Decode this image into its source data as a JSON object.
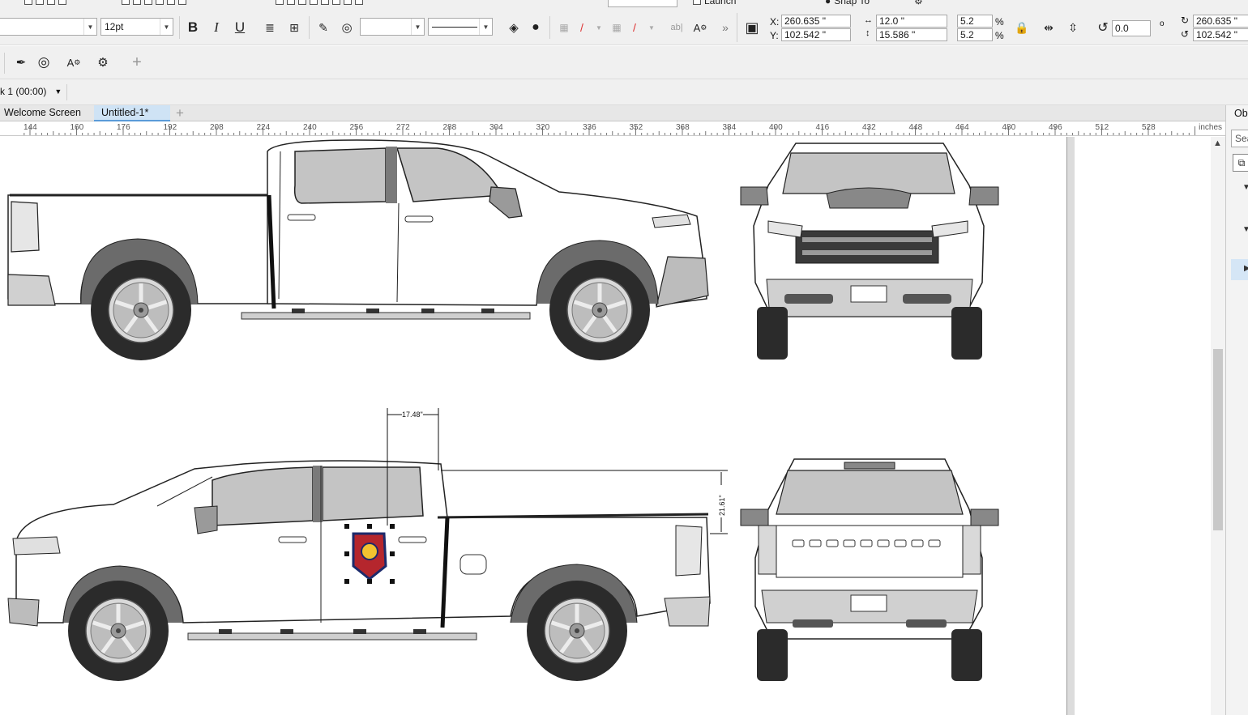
{
  "menu": {
    "launch_label": "Launch",
    "snap_label": "Snap To"
  },
  "toolbar": {
    "font_size": "12pt",
    "pos_x_label": "X:",
    "pos_y_label": "Y:",
    "pos_x": "260.635 \"",
    "pos_y": "102.542 \"",
    "width": "12.0 \"",
    "height": "15.586 \"",
    "scale_x": "5.2",
    "scale_y": "5.2",
    "percent": "%",
    "rotation": "0.0",
    "degree": "o",
    "center_x": "260.635 \"",
    "center_y": "102.542 \"",
    "more": "»",
    "text_ab": "ab|",
    "text_A": "A"
  },
  "page_selector": {
    "label": "k 1 (00:00)"
  },
  "tabs": [
    {
      "label": "Welcome Screen",
      "active": false
    },
    {
      "label": "Untitled-1*",
      "active": true
    }
  ],
  "ruler": {
    "labels": [
      "144",
      "160",
      "176",
      "192",
      "208",
      "224",
      "240",
      "256",
      "272",
      "288",
      "304",
      "320",
      "336",
      "352",
      "368",
      "384",
      "400",
      "416",
      "432",
      "448",
      "464",
      "480",
      "496",
      "512",
      "528"
    ],
    "units": "inches"
  },
  "docker": {
    "title": "Ob",
    "search_placeholder": "Sea"
  },
  "annotations": {
    "width_dim": "17.48\"",
    "height_dim": "21.61\""
  },
  "colors": {
    "accent": "#5a9bd8",
    "window_gray": "#c4c4c4",
    "tire": "#2b2b2b",
    "fender": "#6b6b6b"
  }
}
